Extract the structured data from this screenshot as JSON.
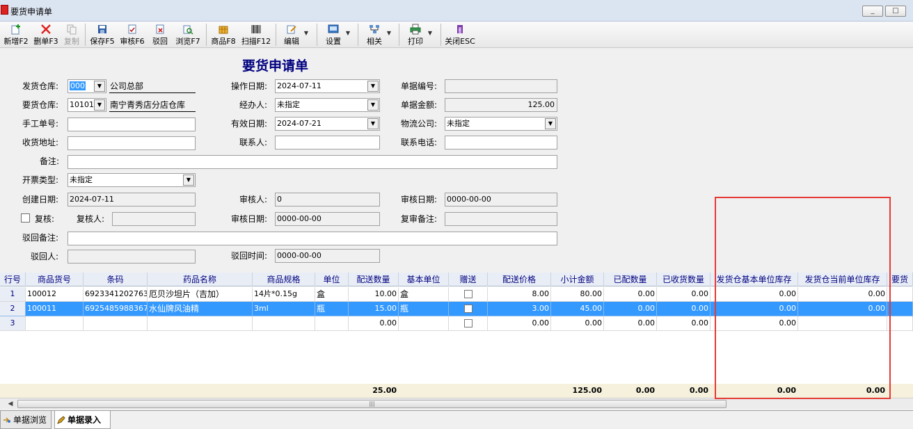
{
  "window": {
    "title": "要货申请单",
    "controls": [
      "_",
      "□",
      "✕"
    ]
  },
  "toolbar": {
    "buttons": [
      {
        "label": "新增F2",
        "icon": "add-icon"
      },
      {
        "label": "删单F3",
        "icon": "delete-icon"
      },
      {
        "label": "复制",
        "icon": "copy-icon",
        "disabled": true
      },
      {
        "label": "保存F5",
        "icon": "save-icon"
      },
      {
        "label": "审核F6",
        "icon": "approve-icon"
      },
      {
        "label": "驳回",
        "icon": "reject-icon"
      },
      {
        "label": "浏览F7",
        "icon": "browse-icon"
      },
      {
        "label": "商品F8",
        "icon": "goods-icon"
      },
      {
        "label": "扫描F12",
        "icon": "barcode-icon"
      },
      {
        "label": "编辑",
        "icon": "edit-icon"
      },
      {
        "label": "设置",
        "icon": "settings-icon"
      },
      {
        "label": "相关",
        "icon": "related-icon"
      },
      {
        "label": "打印",
        "icon": "print-icon"
      },
      {
        "label": "关闭ESC",
        "icon": "close-icon"
      }
    ]
  },
  "form": {
    "title": "要货申请单",
    "labels": {
      "ship_wh": "发货仓库:",
      "req_wh": "要货仓库:",
      "manual_no": "手工单号:",
      "addr": "收货地址:",
      "remark": "备注:",
      "invoice": "开票类型:",
      "created": "创建日期:",
      "recheck": "复核:",
      "rechecker": "复核人:",
      "reject_note": "驳回备注:",
      "rejector": "驳回人:",
      "op_date": "操作日期:",
      "handler": "经办人:",
      "valid_date": "有效日期:",
      "contact": "联系人:",
      "auditor": "审核人:",
      "audit_date": "审核日期:",
      "reject_time": "驳回时间:",
      "doc_no": "单据编号:",
      "doc_amount": "单据金额:",
      "logistics": "物流公司:",
      "phone": "联系电话:",
      "audit_date2": "审核日期:",
      "review_note": "复审备注:"
    },
    "values": {
      "ship_wh_code": "000",
      "ship_wh_name": "公司总部",
      "req_wh_code": "10101",
      "req_wh_name": "南宁青秀店分店仓库",
      "manual_no": "",
      "addr": "",
      "remark": "",
      "invoice": "未指定",
      "created": "2024-07-11",
      "rechecker": "",
      "reject_note": "",
      "rejector": "",
      "op_date": "2024-07-11",
      "handler": "未指定",
      "valid_date": "2024-07-21",
      "contact": "",
      "auditor": "0",
      "audit_date": "0000-00-00",
      "reject_time": "0000-00-00",
      "doc_no": "",
      "doc_amount": "125.00",
      "logistics": "未指定",
      "phone": "",
      "audit_date2": "0000-00-00",
      "review_note": ""
    }
  },
  "grid": {
    "columns": [
      "行号",
      "商品货号",
      "条码",
      "药品名称",
      "商品规格",
      "单位",
      "配送数量",
      "基本单位",
      "赠送",
      "配送价格",
      "小计金额",
      "已配数量",
      "已收货数量",
      "发货仓基本单位库存",
      "发货仓当前单位库存",
      "要货"
    ],
    "rows": [
      {
        "no": "1",
        "code": "100012",
        "barcode": "6923341202763",
        "name": "厄贝沙坦片（吉加）",
        "spec": "14片*0.15g",
        "unit": "盒",
        "qty": "10.00",
        "base_unit": "盒",
        "price": "8.00",
        "subtotal": "80.00",
        "dist": "0.00",
        "recv": "0.00",
        "stock_base": "0.00",
        "stock_cur": "0.00"
      },
      {
        "no": "2",
        "code": "100011",
        "barcode": "6925485988367",
        "name": "水仙牌风油精",
        "spec": "3ml",
        "unit": "瓶",
        "qty": "15.00",
        "base_unit": "瓶",
        "price": "3.00",
        "subtotal": "45.00",
        "dist": "0.00",
        "recv": "0.00",
        "stock_base": "0.00",
        "stock_cur": "0.00"
      },
      {
        "no": "3",
        "code": "",
        "barcode": "",
        "name": "",
        "spec": "",
        "unit": "",
        "qty": "0.00",
        "base_unit": "",
        "price": "0.00",
        "subtotal": "0.00",
        "dist": "0.00",
        "recv": "0.00",
        "stock_base": "0.00",
        "stock_cur": ""
      }
    ],
    "totals": {
      "qty": "25.00",
      "subtotal": "125.00",
      "dist": "0.00",
      "recv": "0.00",
      "stock_base": "0.00",
      "stock_cur": "0.00"
    }
  },
  "tabs": [
    {
      "label": "单据浏览",
      "icon": "browse-doc-icon"
    },
    {
      "label": "单据录入",
      "icon": "entry-pencil-icon",
      "active": true
    }
  ],
  "colors": {
    "accent_red": "#e53935",
    "title_blue": "#000080",
    "selection": "#3399ff"
  }
}
